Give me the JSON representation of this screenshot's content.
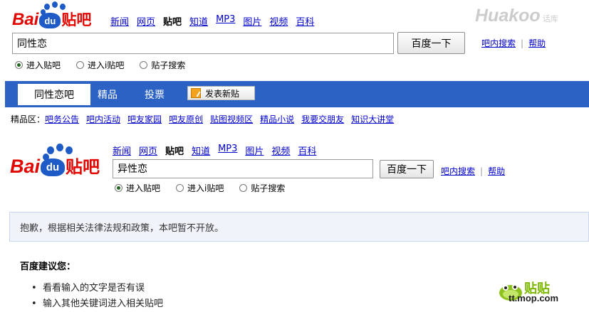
{
  "top": {
    "logo": {
      "bai": "Bai",
      "du": "du",
      "tieba": "贴吧"
    },
    "nav": [
      {
        "label": "新闻",
        "current": false
      },
      {
        "label": "网页",
        "current": false
      },
      {
        "label": "贴吧",
        "current": true
      },
      {
        "label": "知道",
        "current": false
      },
      {
        "label": "MP3",
        "current": false
      },
      {
        "label": "图片",
        "current": false
      },
      {
        "label": "视频",
        "current": false
      },
      {
        "label": "百科",
        "current": false
      }
    ],
    "search_value": "同性恋",
    "search_button": "百度一下",
    "radios": [
      {
        "label": "进入贴吧",
        "checked": true
      },
      {
        "label": "进入i贴吧",
        "checked": false
      },
      {
        "label": "贴子搜索",
        "checked": false
      }
    ],
    "links": {
      "inner_search": "吧内搜索",
      "sep": "|",
      "help": "帮助"
    }
  },
  "watermark": {
    "text": "Huakoo",
    "sub": "话库"
  },
  "tabs": {
    "current": "同性恋吧",
    "items": [
      "精品",
      "投票"
    ],
    "post_button": "发表新贴"
  },
  "jingpin": {
    "prefix": "精品区：",
    "links": [
      "吧务公告",
      "吧内活动",
      "吧友家园",
      "吧友原创",
      "贴图视频区",
      "精品小说",
      "我要交朋友",
      "知识大讲堂"
    ]
  },
  "second": {
    "logo": {
      "bai": "Bai",
      "du": "du",
      "tieba": "贴吧"
    },
    "nav": [
      {
        "label": "新闻",
        "current": false
      },
      {
        "label": "网页",
        "current": false
      },
      {
        "label": "贴吧",
        "current": true
      },
      {
        "label": "知道",
        "current": false
      },
      {
        "label": "MP3",
        "current": false
      },
      {
        "label": "图片",
        "current": false
      },
      {
        "label": "视频",
        "current": false
      },
      {
        "label": "百科",
        "current": false
      }
    ],
    "search_value": "异性恋",
    "search_button": "百度一下",
    "radios": [
      {
        "label": "进入贴吧",
        "checked": true
      },
      {
        "label": "进入i贴吧",
        "checked": false
      },
      {
        "label": "贴子搜索",
        "checked": false
      }
    ],
    "links": {
      "inner_search": "吧内搜索",
      "sep": "|",
      "help": "帮助"
    }
  },
  "notice": "抱歉，根据相关法律法规和政策，本吧暂不开放。",
  "suggest": {
    "title": "百度建议您：",
    "items": [
      "看看输入的文字是否有误",
      "输入其他关键词进入相关贴吧"
    ]
  },
  "mop": {
    "tie": "贴贴",
    "domain": "tt.mop.com"
  },
  "colors": {
    "brand_red": "#e10600",
    "brand_blue": "#1e5bc6",
    "tab_blue": "#2b62c3",
    "link": "#0000cc"
  }
}
